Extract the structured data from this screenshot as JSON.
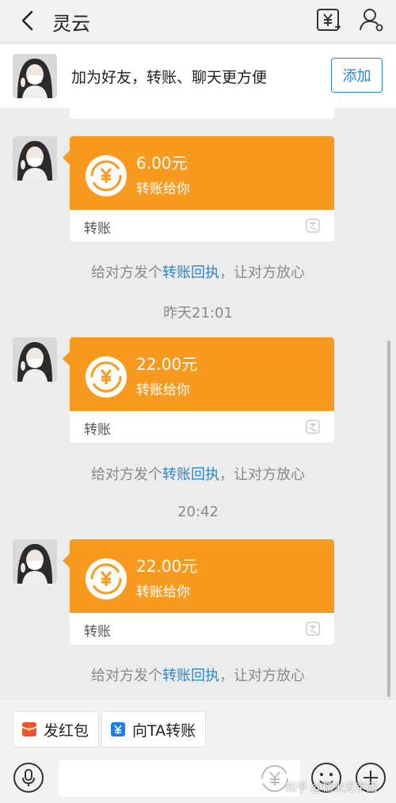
{
  "header": {
    "title": "灵云",
    "back_icon": "chevron-left-icon",
    "transfer_icon": "yuan-transfer-icon",
    "profile_icon": "person-icon"
  },
  "banner": {
    "text": "加为好友，转账、聊天更方便",
    "add_label": "添加"
  },
  "messages": [
    {
      "amount": "6.00元",
      "subtitle": "转账给你",
      "type": "转账"
    },
    {
      "amount": "22.00元",
      "subtitle": "转账给你",
      "type": "转账"
    },
    {
      "amount": "22.00元",
      "subtitle": "转账给你",
      "type": "转账"
    }
  ],
  "receipt": {
    "prefix": "给对方发个",
    "link": "转账回执",
    "suffix": "，让对方放心"
  },
  "timestamps": [
    "昨天21:01",
    "20:42"
  ],
  "quick_actions": [
    {
      "label": "发红包",
      "icon": "red-packet-icon",
      "color": "#f0562e"
    },
    {
      "label": "向TA转账",
      "icon": "yuan-transfer-icon",
      "color": "#1f7fe8"
    }
  ],
  "input": {
    "value": "",
    "placeholder": ""
  },
  "watermark": "知乎 @糯米无字团",
  "colors": {
    "transfer_orange": "#f79a1e",
    "link_blue": "#2a86c8"
  }
}
